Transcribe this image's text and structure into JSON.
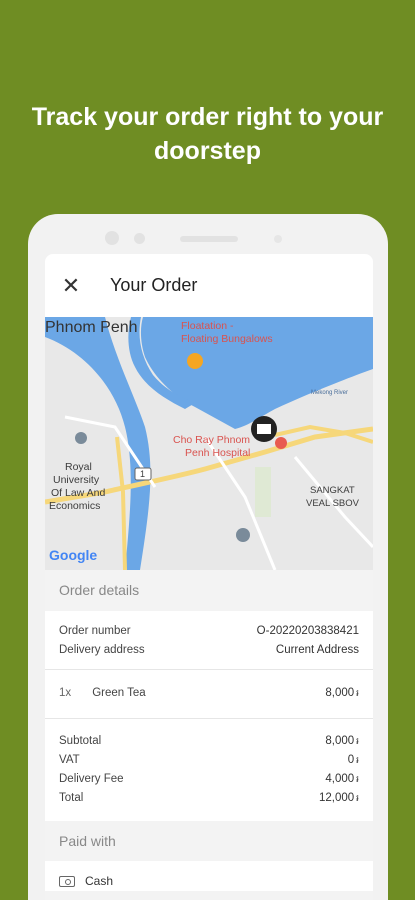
{
  "headline": "Track your order right to your doorstep",
  "app_bar": {
    "title": "Your Order",
    "close_icon": "close-icon"
  },
  "map": {
    "city_label": "Phnom Penh",
    "labels": {
      "floatation_1": "Floatation -",
      "floatation_2": "Floating Bungalows",
      "river": "Mekong River",
      "hospital_1": "Cho Ray Phnom",
      "hospital_2": "Penh Hospital",
      "university_1": "Royal",
      "university_2": "University",
      "university_3": "Of Law And",
      "university_4": "Economics",
      "sangkat_1": "SANGKAT",
      "sangkat_2": "VEAL SBOV",
      "road_number": "1",
      "google": "Google"
    },
    "colors": {
      "water": "#6ba7e6",
      "road": "#f6d77a",
      "land": "#e8e8e8"
    }
  },
  "order_details": {
    "section_title": "Order details",
    "order_number_label": "Order number",
    "order_number_value": "O-20220203838421",
    "delivery_address_label": "Delivery address",
    "delivery_address_value": "Current Address",
    "items": [
      {
        "qty": "1x",
        "name": "Green Tea",
        "price": "8,000",
        "currency": "៛"
      }
    ],
    "summary": {
      "subtotal_label": "Subtotal",
      "subtotal_value": "8,000",
      "vat_label": "VAT",
      "vat_value": "0",
      "delivery_fee_label": "Delivery Fee",
      "delivery_fee_value": "4,000",
      "total_label": "Total",
      "total_value": "12,000",
      "currency": "៛"
    }
  },
  "payment": {
    "section_title": "Paid with",
    "method": "Cash",
    "method_icon": "cash-icon"
  },
  "colors": {
    "background": "#6f8d23",
    "phone": "#f2f2f2",
    "pin_red": "#e85b50",
    "pin_orange": "#f5a623"
  }
}
